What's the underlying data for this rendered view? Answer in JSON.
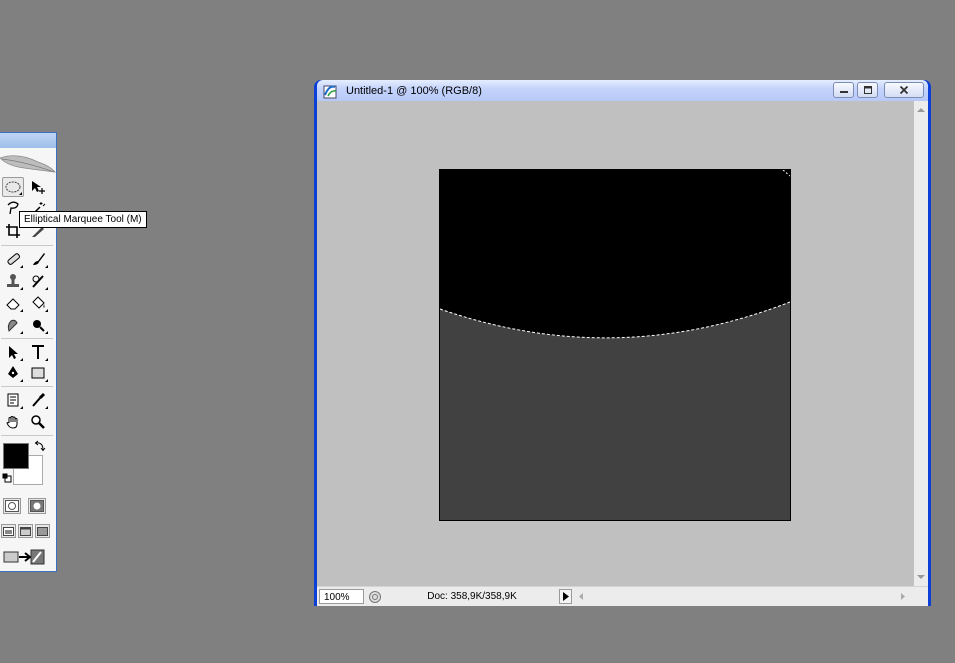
{
  "tooltip": {
    "text": "Elliptical Marquee Tool (M)"
  },
  "toolbox": {
    "tools": [
      "elliptical-marquee-tool",
      "move-tool",
      "lasso-tool",
      "magic-wand-tool",
      "crop-tool",
      "slice-tool",
      "healing-brush-tool",
      "brush-tool",
      "clone-stamp-tool",
      "history-brush-tool",
      "eraser-tool",
      "paint-bucket-tool",
      "blur-tool",
      "dodge-tool",
      "path-selection-tool",
      "type-tool",
      "pen-tool",
      "rectangle-tool",
      "notes-tool",
      "eyedropper-tool",
      "hand-tool",
      "zoom-tool"
    ],
    "selected_tool": "elliptical-marquee-tool",
    "foreground_color": "#000000",
    "background_color": "#ffffff"
  },
  "document": {
    "title": "Untitled-1 @ 100% (RGB/8)",
    "zoom": "100%",
    "doc_info": "Doc: 358,9K/358,9K",
    "canvas_base_color": "#414141",
    "selection_fill_color": "#000000"
  },
  "colors": {
    "desktop": "#808080",
    "canvas_area": "#c0c0c0",
    "title_bar_border": "#0b3fd8"
  }
}
